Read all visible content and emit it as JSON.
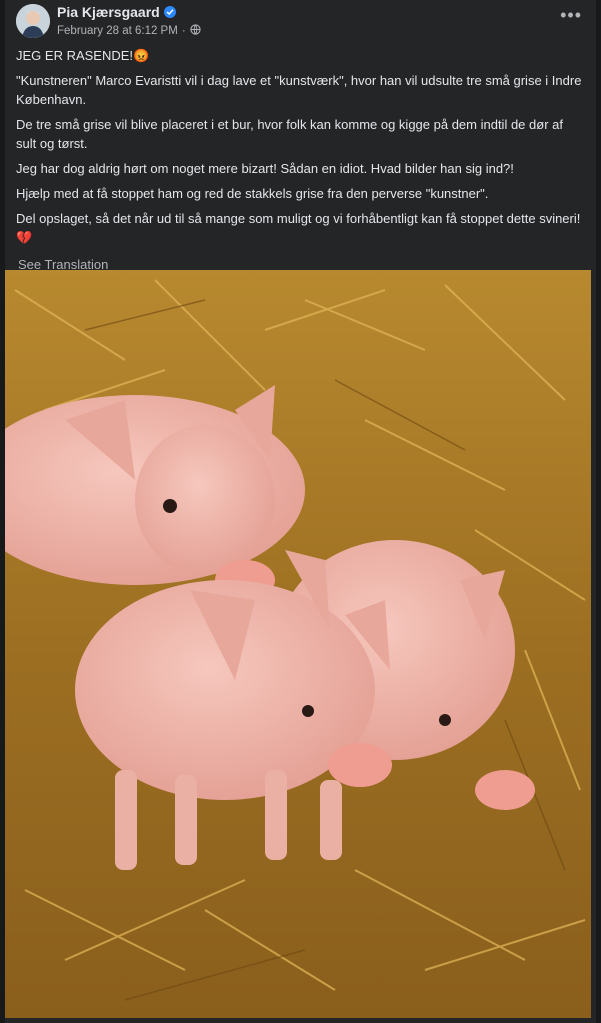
{
  "post": {
    "author": "Pia Kjærsgaard",
    "timestamp": "February 28 at 6:12 PM",
    "separator": "·",
    "audience_icon": "globe-icon",
    "more_icon": "more-options-icon",
    "more_label": "•••",
    "paragraphs": [
      "JEG ER RASENDE!😡",
      "\"Kunstneren\" Marco Evaristti vil i dag lave et \"kunstværk\", hvor han vil udsulte tre små grise i Indre København.",
      "De tre små grise vil blive placeret i et bur, hvor folk kan komme og kigge på dem indtil de dør af sult og tørst.",
      "Jeg har dog aldrig hørt om noget mere bizart! Sådan en idiot. Hvad bilder han sig ind?!",
      "Hjælp med at få stoppet ham og red de stakkels grise fra den perverse \"kunstner\".",
      "Del opslaget, så det når ud til så mange som muligt og vi forhåbentligt kan få stoppet dette svineri!💔"
    ],
    "see_translation": "See Translation",
    "photo_subject": "three piglets in straw"
  },
  "colors": {
    "background": "#18191a",
    "card": "#242526",
    "primary_text": "#e4e6eb",
    "secondary_text": "#b0b3b8",
    "verified_badge": "#2d88ff"
  }
}
